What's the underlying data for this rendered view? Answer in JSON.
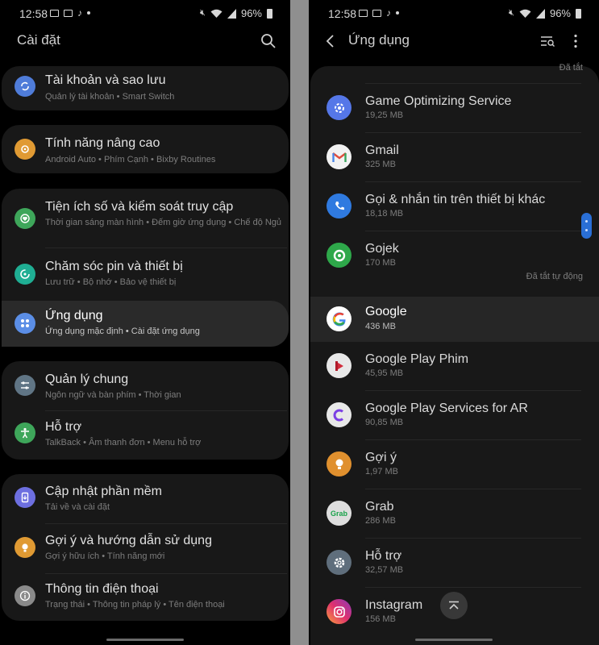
{
  "status": {
    "time": "12:58",
    "battery": "96%"
  },
  "left": {
    "title": "Cài đặt",
    "groups": [
      [
        {
          "title": "Tài khoản và sao lưu",
          "subtitle": "Quản lý tài khoản  •  Smart Switch"
        }
      ],
      [
        {
          "title": "Tính năng nâng cao",
          "subtitle": "Android Auto  •  Phím Cạnh  •  Bixby Routines"
        }
      ],
      [
        {
          "title": "Tiện ích số và kiểm soát truy cập",
          "subtitle": "Thời gian sáng màn hình  •  Đếm giờ ứng dụng  •  Chế độ Ngủ"
        },
        {
          "title": "Chăm sóc pin và thiết bị",
          "subtitle": "Lưu trữ  •  Bộ nhớ  •  Bảo vệ thiết bị"
        },
        {
          "title": "Ứng dụng",
          "subtitle": "Ứng dụng mặc định  •  Cài đặt ứng dụng"
        }
      ],
      [
        {
          "title": "Quản lý chung",
          "subtitle": "Ngôn ngữ và bàn phím  •  Thời gian"
        },
        {
          "title": "Hỗ trợ",
          "subtitle": "TalkBack  •  Âm thanh đơn  •  Menu hỗ trợ"
        }
      ],
      [
        {
          "title": "Cập nhật phần mềm",
          "subtitle": "Tải về và cài đặt"
        },
        {
          "title": "Gợi ý và hướng dẫn sử dụng",
          "subtitle": "Gợi ý hữu ích  •  Tính năng mới"
        },
        {
          "title": "Thông tin điện thoại",
          "subtitle": "Trạng thái  •  Thông tin pháp lý  •  Tên điện thoại"
        }
      ]
    ]
  },
  "right": {
    "title": "Ứng dụng",
    "top_partial_label": "Đã tắt",
    "apps": [
      {
        "name": "Game Optimizing Service",
        "size": "19,25 MB"
      },
      {
        "name": "Gmail",
        "size": "325 MB"
      },
      {
        "name": "Gọi & nhắn tin trên thiết bị khác",
        "size": "18,18 MB"
      },
      {
        "name": "Gojek",
        "size": "170 MB",
        "status": "Đã tắt tự động"
      },
      {
        "name": "Google",
        "size": "436 MB"
      },
      {
        "name": "Google Play Phim",
        "size": "45,95 MB"
      },
      {
        "name": "Google Play Services for AR",
        "size": "90,85 MB"
      },
      {
        "name": "Gợi ý",
        "size": "1,97 MB"
      },
      {
        "name": "Grab",
        "size": "286 MB"
      },
      {
        "name": "Hỗ trợ",
        "size": "32,57 MB"
      },
      {
        "name": "Instagram",
        "size": "156 MB"
      }
    ]
  },
  "colors": {
    "accounts": "#4f7cd9",
    "advanced": "#e09a33",
    "wellbeing": "#3ea65a",
    "battery_care": "#1fae93",
    "apps": "#5b8ee6",
    "general": "#607585",
    "accessibility": "#3ea65a",
    "software_update": "#6d6fe0",
    "tips": "#e09a33",
    "about": "#8a8a8a"
  }
}
